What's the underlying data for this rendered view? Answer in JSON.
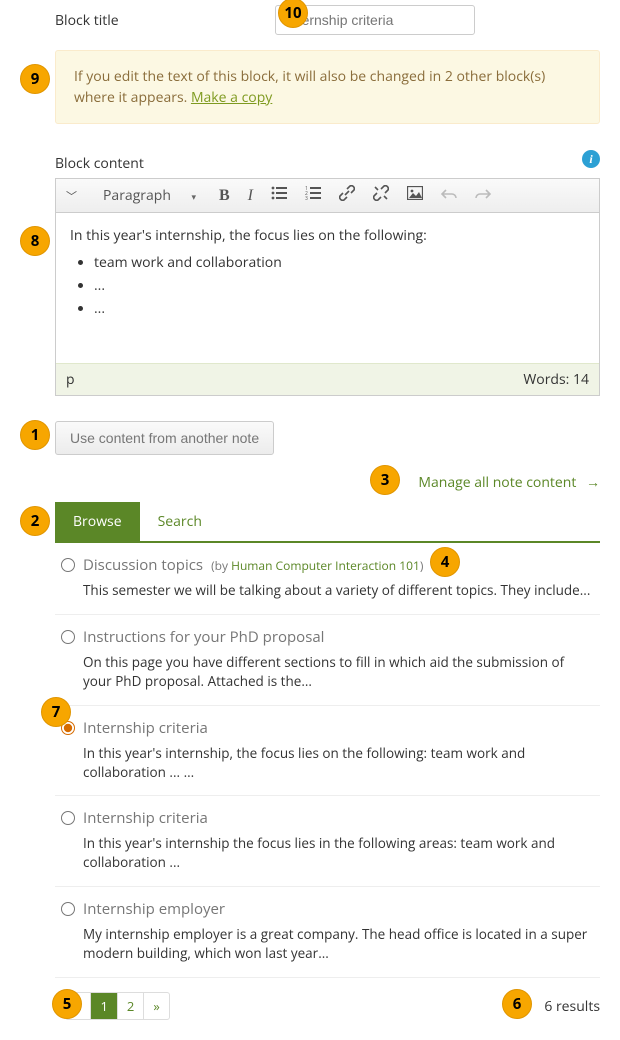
{
  "markers": {
    "m1": "1",
    "m2": "2",
    "m3": "3",
    "m4": "4",
    "m5": "5",
    "m6": "6",
    "m7": "7",
    "m8": "8",
    "m9": "9",
    "m10": "10"
  },
  "labels": {
    "block_title": "Block title",
    "block_content": "Block content",
    "use_content_btn": "Use content from another note",
    "manage_link": "Manage all note content",
    "results": "6 results"
  },
  "title_input": {
    "value": "Internship criteria"
  },
  "warning": {
    "text": "If you edit the text of this block, it will also be changed in 2 other block(s) where it appears. ",
    "link": "Make a copy"
  },
  "editor": {
    "paragraph_label": "Paragraph",
    "body_intro": "In this year's internship, the focus lies on the following:",
    "bullets": [
      "team work and collaboration",
      "...",
      "..."
    ],
    "path": "p",
    "wordcount": "Words: 14"
  },
  "tabs": {
    "browse": "Browse",
    "search": "Search"
  },
  "notes": [
    {
      "title": "Discussion topics",
      "author_prefix": "(by ",
      "author_group": "Human Computer Interaction 101",
      "author_suffix": ")",
      "desc": "This semester we will be talking about a variety of different topics. They include...",
      "selected": false,
      "show_author": true
    },
    {
      "title": "Instructions for your PhD proposal",
      "desc": "On this page you have different sections to fill in which aid the submission of your PhD proposal. Attached is the...",
      "selected": false,
      "show_author": false
    },
    {
      "title": "Internship criteria",
      "desc": "In this year's internship, the focus lies on the following: team work and collaboration ... ...",
      "selected": true,
      "show_author": false
    },
    {
      "title": "Internship criteria",
      "desc": "In this year's internship the focus lies in the following areas: team work and collaboration ...",
      "selected": false,
      "show_author": false
    },
    {
      "title": "Internship employer",
      "desc": "My internship employer is a great company. The head office is located in a super modern building, which won last year...",
      "selected": false,
      "show_author": false
    }
  ],
  "pager": {
    "prev": "«",
    "p1": "1",
    "p2": "2",
    "next": "»"
  }
}
